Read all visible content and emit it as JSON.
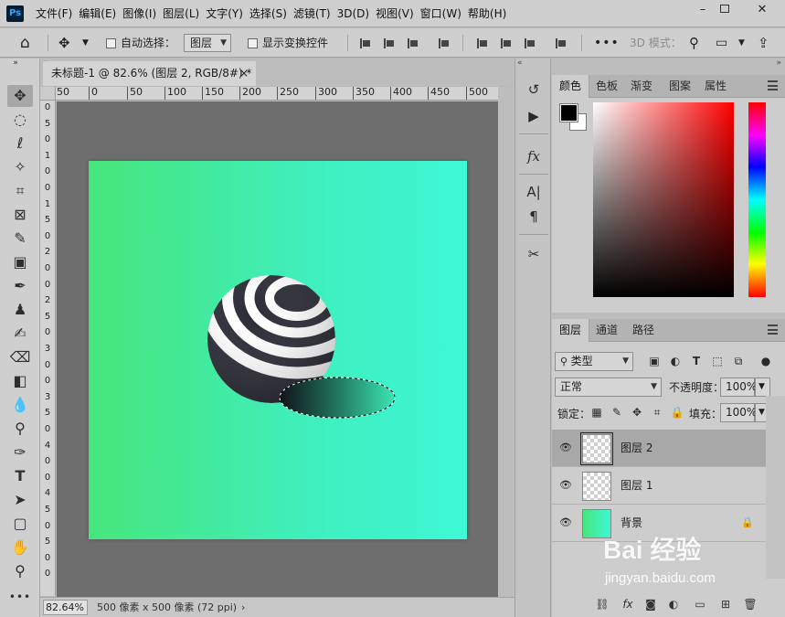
{
  "app": {
    "logo": "Ps"
  },
  "menu": [
    "文件(F)",
    "编辑(E)",
    "图像(I)",
    "图层(L)",
    "文字(Y)",
    "选择(S)",
    "滤镜(T)",
    "3D(D)",
    "视图(V)",
    "窗口(W)",
    "帮助(H)"
  ],
  "options_bar": {
    "auto_select_label": "自动选择：",
    "auto_select_target": "图层",
    "show_transform_label": "显示变换控件",
    "mode_3d_label": "3D 模式："
  },
  "document": {
    "tab_title": "未标题-1 @ 82.6% (图层 2, RGB/8#) *",
    "close_glyph": "×"
  },
  "ruler": {
    "h_labels": [
      "50",
      "0",
      "50",
      "100",
      "150",
      "200",
      "250",
      "300",
      "350",
      "400",
      "450",
      "500"
    ],
    "v_labels": [
      "0",
      "5",
      "0",
      "1",
      "0",
      "0",
      "1",
      "5",
      "0",
      "2",
      "0",
      "0",
      "2",
      "5",
      "0",
      "3",
      "0",
      "0",
      "3",
      "5",
      "0",
      "4",
      "0",
      "0",
      "4",
      "5",
      "0",
      "5",
      "0",
      "0"
    ]
  },
  "status": {
    "zoom": "82.64%",
    "doc_info": "500 像素 x 500 像素 (72 ppi)",
    "arrow": "›"
  },
  "color_panel": {
    "tabs": [
      "颜色",
      "色板",
      "渐变",
      "图案",
      "属性"
    ],
    "foreground": "#000000",
    "background": "#ffffff"
  },
  "layers_panel": {
    "tabs": [
      "图层",
      "通道",
      "路径"
    ],
    "filter_kind": "类型",
    "blend_mode": "正常",
    "opacity_label": "不透明度：",
    "opacity_value": "100%",
    "lock_label": "锁定：",
    "fill_label": "填充：",
    "fill_value": "100%",
    "layers": [
      {
        "name": "图层 2",
        "selected": true
      },
      {
        "name": "图层 1",
        "selected": false
      },
      {
        "name": "背景",
        "selected": false,
        "locked": true
      }
    ]
  },
  "canvas": {
    "gradient_start": "#47e57c",
    "gradient_end": "#3ef8d6",
    "ball_dark": "#2b2b36",
    "ball_light": "#ffffff"
  },
  "watermark": {
    "title": "Bai 经验",
    "url": "jingyan.baidu.com"
  }
}
